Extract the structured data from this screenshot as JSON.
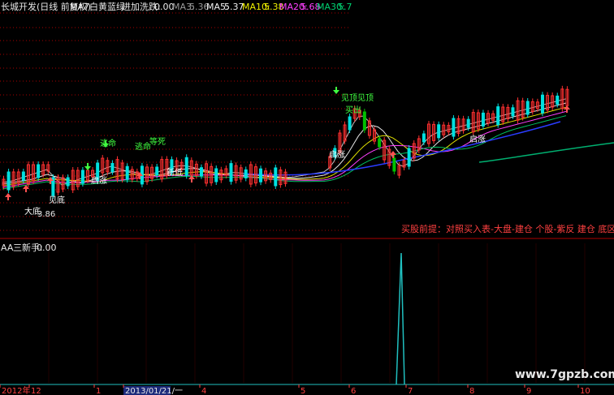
{
  "header": {
    "title": "长城开发(日线 前复权)",
    "indicator_name": "MA7白黄蓝绿",
    "flush_label": "进加洗跌:",
    "flush_value": "0.00",
    "ma3_label": "MA3:",
    "ma3_value": "5.36",
    "ma5_label": "MA5:",
    "ma5_value": "5.37",
    "ma10_label": "MA10:",
    "ma10_value": "5.38",
    "ma20_label": "MA20:",
    "ma20_value": "5.68",
    "ma30_label": "MA30:",
    "ma30_value": "5.7"
  },
  "sub_panel": {
    "indicator": "AA",
    "name": "三新手:",
    "value": "0.00"
  },
  "annotations": {
    "buy_note": "买股前提：对照买入表-大盘-建仓  个股-紫反 建仓 底区",
    "watermark": "www.7gpzb.com"
  },
  "chart_data": {
    "type": "candlestick",
    "title": "长城开发(日线 前复权)",
    "main_panel_markers": [
      {
        "label": "逃命",
        "kind": "sell"
      },
      {
        "label": "逃命",
        "kind": "sell"
      },
      {
        "label": "等死",
        "kind": "sell"
      },
      {
        "label": "见底",
        "kind": "buy"
      },
      {
        "label": "大底",
        "kind": "buy"
      },
      {
        "label": "启涨",
        "kind": "buy"
      },
      {
        "label": "新低",
        "kind": "buy"
      },
      {
        "label": "启涨",
        "kind": "buy"
      },
      {
        "label": "见顶",
        "kind": "sell"
      },
      {
        "label": "见顶",
        "kind": "sell"
      },
      {
        "label": "买出",
        "kind": "sell"
      },
      {
        "label": "启涨",
        "kind": "buy"
      }
    ],
    "low_price_label": "3.86",
    "moving_averages": [
      {
        "name": "MA3",
        "value": 5.36,
        "color": "#c0c0c0"
      },
      {
        "name": "MA5",
        "value": 5.37,
        "color": "#e6e6e6"
      },
      {
        "name": "MA10",
        "value": 5.38,
        "color": "#e0e000"
      },
      {
        "name": "MA20",
        "value": 5.68,
        "color": "#ff40ff"
      },
      {
        "name": "MA30",
        "value": 5.7,
        "color": "#00c060"
      }
    ],
    "sub_panel_series": {
      "name": "三新手",
      "spike_at_label": "7",
      "spike_value": 1
    },
    "x_tick_labels": [
      "2012年",
      "12",
      "1",
      "2013/01/21/一",
      "4",
      "5",
      "6",
      "7",
      "8",
      "9",
      "10"
    ],
    "colors": {
      "up": "#ff3030",
      "down": "#00e0e0",
      "dn_big": "#00c000",
      "background": "#000000",
      "grid": "#aa0000"
    }
  }
}
